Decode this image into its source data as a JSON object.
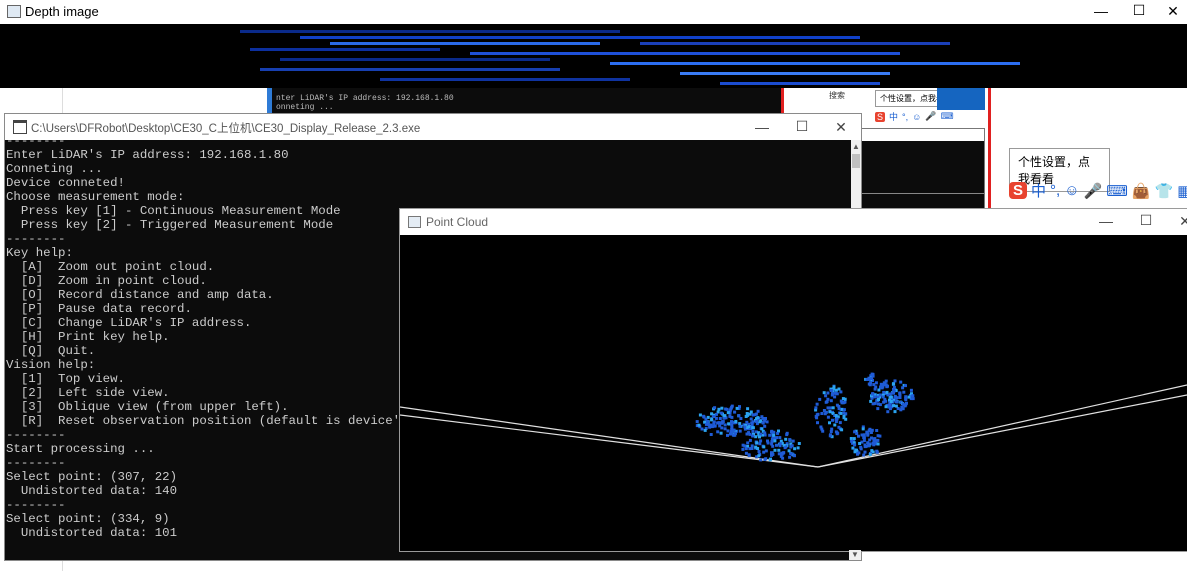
{
  "depth_window": {
    "title": "Depth image",
    "controls": {
      "minimize": "—",
      "maximize": "☐",
      "close": "✕"
    }
  },
  "background_console": {
    "lines": [
      "nter LiDAR's IP address: 192.168.1.80",
      "onneting ..."
    ]
  },
  "background_app": {
    "search_label": "搜索",
    "tooltip_small": "个性设置，点我看看",
    "tooltip_large": "个性设置，点我看看",
    "ime_items": [
      "S",
      "中",
      "°,",
      "☺",
      "🎤",
      "⌨",
      "👜",
      "👕",
      "▦"
    ]
  },
  "console_window": {
    "title": "C:\\Users\\DFRobot\\Desktop\\CE30_C上位机\\CE30_Display_Release_2.3.exe",
    "controls": {
      "minimize": "—",
      "maximize": "☐",
      "close": "✕"
    },
    "text": "--------\nEnter LiDAR's IP address: 192.168.1.80\nConneting ...\nDevice conneted!\nChoose measurement mode:\n  Press key [1] - Continuous Measurement Mode\n  Press key [2] - Triggered Measurement Mode\n--------\nKey help:\n  [A]  Zoom out point cloud.\n  [D]  Zoom in point cloud.\n  [O]  Record distance and amp data.\n  [P]  Pause data record.\n  [C]  Change LiDAR's IP address.\n  [H]  Print key help.\n  [Q]  Quit.\nVision help:\n  [1]  Top view.\n  [2]  Left side view.\n  [3]  Oblique view (from upper left).\n  [R]  Reset observation position (default is device's po\n--------\nStart processing ...\n--------\nSelect point: (307, 22)\n  Undistorted data: 140\n--------\nSelect point: (334, 9)\n  Undistorted data: 101"
  },
  "pointcloud_window": {
    "title": "Point Cloud",
    "controls": {
      "minimize": "—",
      "maximize": "☐",
      "close": "✕"
    }
  },
  "colors": {
    "console_bg": "#0c0c0c",
    "console_text": "#cccccc",
    "point_blue": "#1f5bd6",
    "point_cyan": "#2aa3f0"
  }
}
